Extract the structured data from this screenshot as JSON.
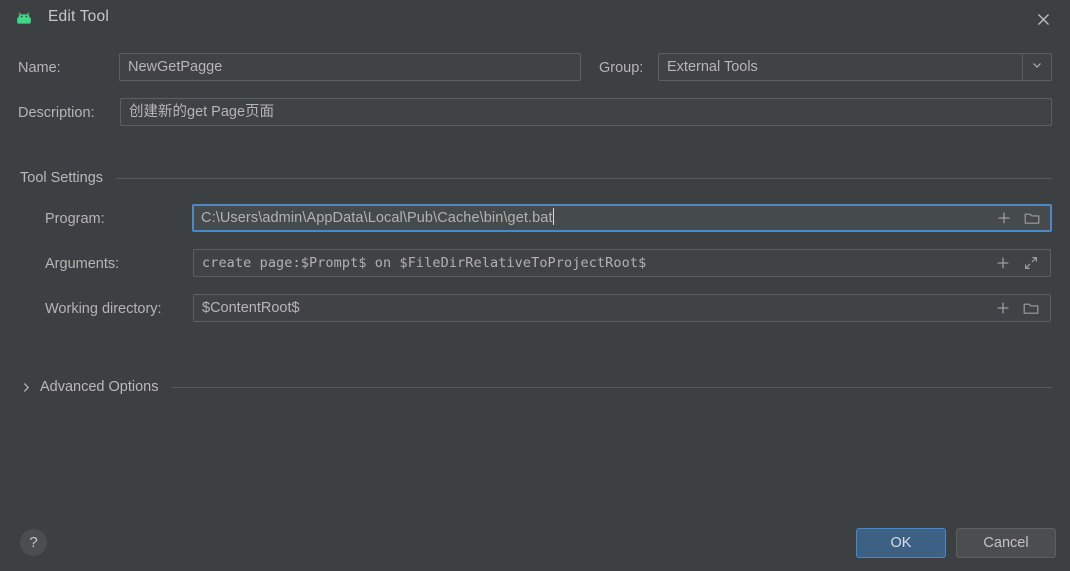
{
  "window": {
    "title": "Edit Tool",
    "app_icon": "android-robot-icon",
    "close_icon": "close-icon",
    "accent_color": "#4b88c7",
    "background_color": "#3c4042",
    "icon_color": "#3ddb85"
  },
  "form": {
    "name": {
      "label": "Name:",
      "value": "NewGetPagge",
      "placeholder": ""
    },
    "group": {
      "label": "Group:",
      "value": "External Tools",
      "dropdown_icon": "chevron-down-icon",
      "options": [
        "External Tools"
      ]
    },
    "description": {
      "label": "Description:",
      "value": "创建新的get Page页面",
      "placeholder": ""
    }
  },
  "tool_settings": {
    "header": "Tool Settings",
    "program": {
      "label": "Program:",
      "value": "C:\\Users\\admin\\AppData\\Local\\Pub\\Cache\\bin\\get.bat",
      "focused": true,
      "insert_macro_icon": "plus-icon",
      "browse_icon": "folder-icon"
    },
    "arguments": {
      "label": "Arguments:",
      "value": "create page:$Prompt$ on $FileDirRelativeToProjectRoot$",
      "insert_macro_icon": "plus-icon",
      "expand_icon": "expand-icon"
    },
    "working_directory": {
      "label": "Working directory:",
      "value": "$ContentRoot$",
      "insert_macro_icon": "plus-icon",
      "browse_icon": "folder-icon"
    }
  },
  "advanced_options": {
    "header": "Advanced Options",
    "expanded": false,
    "chevron_icon": "chevron-right-icon"
  },
  "footer": {
    "help_label": "?",
    "ok_label": "OK",
    "cancel_label": "Cancel"
  }
}
